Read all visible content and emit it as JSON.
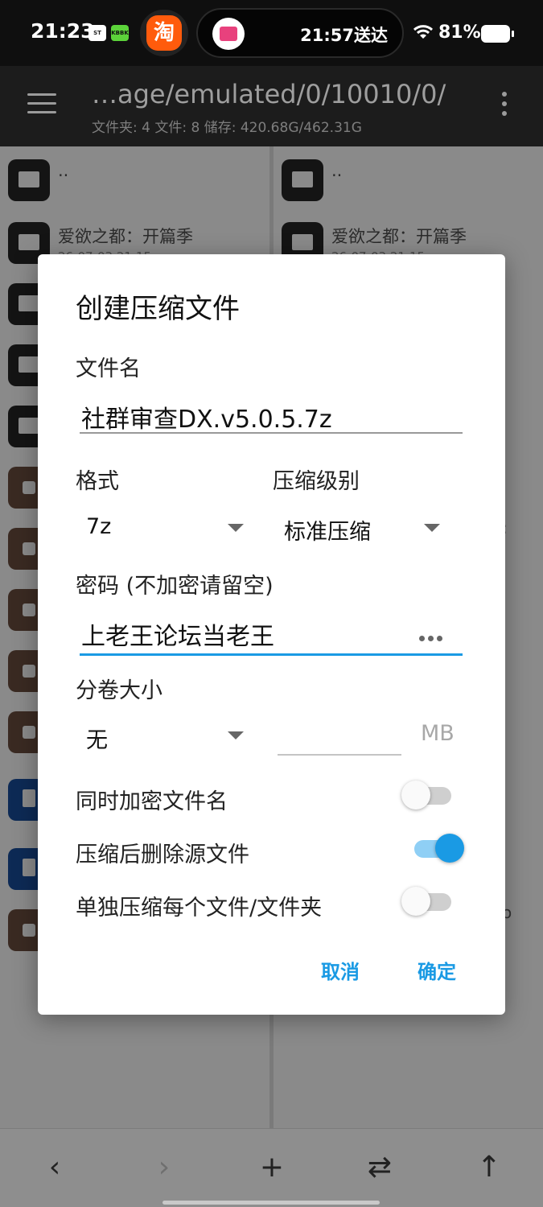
{
  "status_bar": {
    "time": "21:23",
    "mini_icon_a": "ST",
    "mini_icon_b": "KBBK",
    "taobao_glyph": "淘",
    "delivery_text": "21:57送达",
    "battery": "81%"
  },
  "app_bar": {
    "path": "…age/emulated/0/10010/0/",
    "summary": "文件夹: 4  文件: 8  储存: 420.68G/462.31G"
  },
  "left_panel": {
    "rows": [
      {
        "name": "..",
        "date": "",
        "type": "folder"
      },
      {
        "name": "爱欲之都：开篇季",
        "date": "26-07-03 21:15",
        "type": "folder"
      },
      {
        "name": "",
        "date": "",
        "type": "folder"
      },
      {
        "name": "",
        "date": "",
        "type": "folder"
      },
      {
        "name": "",
        "date": "",
        "type": "folder"
      },
      {
        "name": "",
        "date": "",
        "type": "archive"
      },
      {
        "name": "",
        "date": "",
        "type": "archive"
      },
      {
        "name": "",
        "date": "",
        "type": "archive"
      },
      {
        "name": "",
        "date": "",
        "type": "archive"
      },
      {
        "name": "",
        "date": "",
        "type": "archive"
      },
      {
        "name": "",
        "date": "",
        "type": "doc"
      },
      {
        "name": "",
        "date": "",
        "type": "doc"
      },
      {
        "name": "",
        "date": "",
        "type": "archive"
      }
    ]
  },
  "right_panel": {
    "rows": [
      {
        "name": "..",
        "date": ""
      },
      {
        "name": "爱欲之都：开篇季",
        "date": "26-07-03 21:15"
      }
    ],
    "trunc_a": ":",
    "trunc_b": "o"
  },
  "dialog": {
    "title": "创建压缩文件",
    "filename_label": "文件名",
    "filename_value": "社群审查DX.v5.0.5.7z",
    "format_label": "格式",
    "format_value": "7z",
    "level_label": "压缩级别",
    "level_value": "标准压缩",
    "password_label": "密码 (不加密请留空)",
    "password_value": "上老王论坛当老王",
    "split_label": "分卷大小",
    "split_value": "无",
    "split_size_value": "",
    "split_unit": "MB",
    "encrypt_names_label": "同时加密文件名",
    "encrypt_names_on": false,
    "delete_source_label": "压缩后删除源文件",
    "delete_source_on": true,
    "separate_label": "单独压缩每个文件/文件夹",
    "separate_on": false,
    "cancel_label": "取消",
    "ok_label": "确定"
  },
  "bottom_bar": {
    "back": "‹",
    "forward": "›",
    "add": "+",
    "swap": "⇄",
    "up": "↑"
  },
  "colors": {
    "accent": "#1a9ae4",
    "scrim": "#8e8e8e"
  }
}
